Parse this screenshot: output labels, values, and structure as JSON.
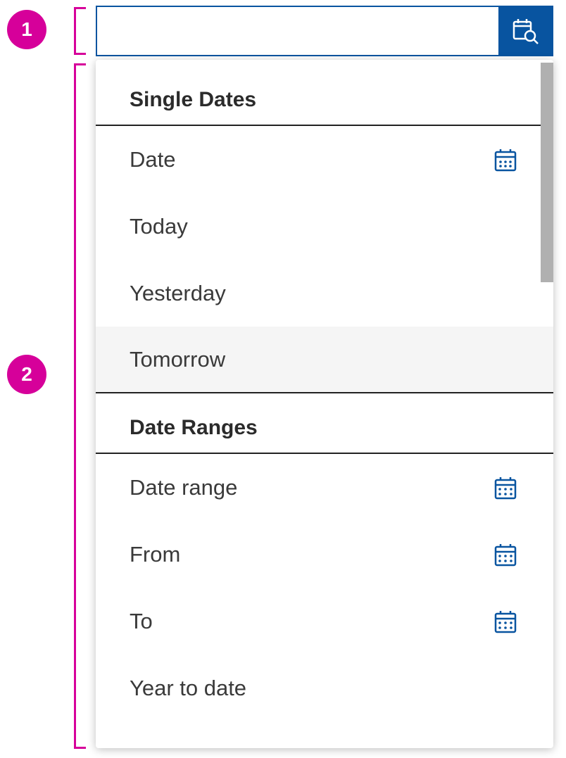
{
  "annotations": {
    "badge1": "1",
    "badge2": "2"
  },
  "input": {
    "value": "",
    "placeholder": ""
  },
  "groups": [
    {
      "title": "Single Dates",
      "options": [
        {
          "label": "Date",
          "icon": "calendar-single"
        },
        {
          "label": "Today",
          "icon": null
        },
        {
          "label": "Yesterday",
          "icon": null
        },
        {
          "label": "Tomorrow",
          "icon": null,
          "hovered": true
        }
      ]
    },
    {
      "title": "Date Ranges",
      "options": [
        {
          "label": "Date range",
          "icon": "calendar-range"
        },
        {
          "label": "From",
          "icon": "calendar-range"
        },
        {
          "label": "To",
          "icon": "calendar-range"
        },
        {
          "label": "Year to date",
          "icon": null
        }
      ]
    }
  ],
  "colors": {
    "accent": "#0854a0",
    "annotation": "#d6009a"
  }
}
